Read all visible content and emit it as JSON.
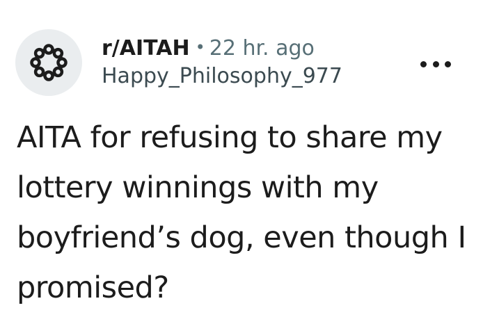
{
  "post": {
    "subreddit": "r/AITAH",
    "separator": "•",
    "time": "22 hr. ago",
    "author": "Happy_Philosophy_977",
    "title": "AITA for refusing to share my lottery winnings with my boyfriend’s dog, even though I promised?"
  },
  "icons": {
    "avatar": "subreddit-avatar-icon",
    "more": "more-options-icon"
  },
  "colors": {
    "text": "#1c1c1c",
    "muted": "#576f76",
    "avatar_bg": "#eaedef"
  }
}
